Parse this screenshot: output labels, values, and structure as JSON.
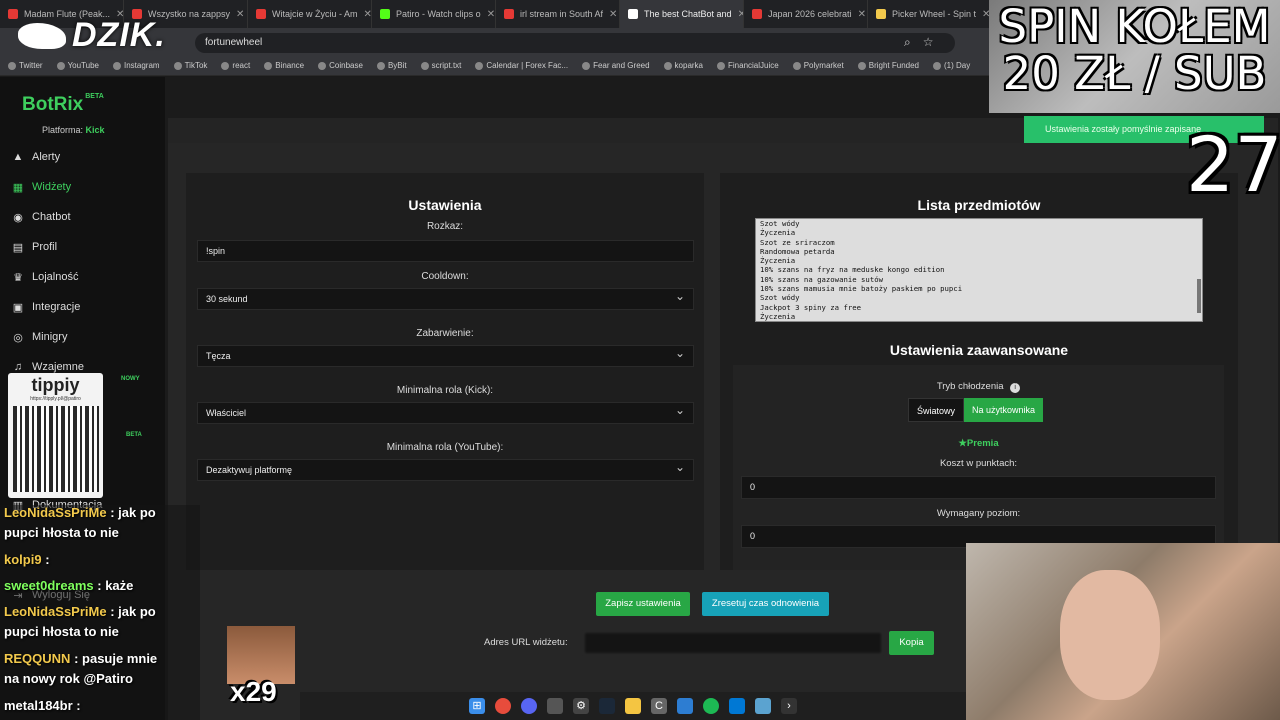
{
  "browser": {
    "tabs": [
      {
        "label": "Madam Flute (Peak...",
        "color": "#e53935"
      },
      {
        "label": "Wszystko na zappsy",
        "color": "#e53935"
      },
      {
        "label": "Witajcie w Życiu - Am",
        "color": "#e53935"
      },
      {
        "label": "Patiro - Watch clips o",
        "color": "#53fc18"
      },
      {
        "label": "irl stream in South Af",
        "color": "#e53935"
      },
      {
        "label": "The best ChatBot and",
        "color": "#ffffff"
      },
      {
        "label": "Japan 2026 celebrati",
        "color": "#e53935"
      },
      {
        "label": "Picker Wheel - Spin t",
        "color": "#f2c94c"
      }
    ],
    "address": "fortunewheel",
    "bookmarks": [
      "Twitter",
      "YouTube",
      "Instagram",
      "TikTok",
      "react",
      "Binance",
      "Coinbase",
      "ByBit",
      "script.txt",
      "Calendar | Forex Fac...",
      "Fear and Greed",
      "koparka",
      "FinancialJuice",
      "Polymarket",
      "Bright Funded",
      "(1) Day"
    ]
  },
  "overlay": {
    "dzik_logo": "DZIK.",
    "spin_line1": "SPIN KOŁEM",
    "spin_line2": "20 ZŁ / SUB",
    "counter": "27",
    "qr_title": "tippiy",
    "qr_url": "https://tipply.pl/@patiro",
    "emote_count": "x29"
  },
  "sidebar": {
    "brand": "BotRix",
    "brand_badge": "BETA",
    "platform_label": "Platforma:",
    "platform_value": "Kick",
    "items": [
      {
        "label": "Alerty",
        "icon": "bell-icon"
      },
      {
        "label": "Widżety",
        "icon": "grid-icon"
      },
      {
        "label": "Chatbot",
        "icon": "robot-icon"
      },
      {
        "label": "Profil",
        "icon": "id-card-icon"
      },
      {
        "label": "Lojalność",
        "icon": "trophy-icon"
      },
      {
        "label": "Integracje",
        "icon": "gear-icon"
      },
      {
        "label": "Minigry",
        "icon": "gamepad-icon"
      },
      {
        "label": "Wzajemne",
        "icon": "music-icon"
      },
      {
        "label": "Dokumentacja",
        "icon": "book-icon"
      },
      {
        "label": "Wyloguj Się",
        "icon": "logout-icon"
      }
    ],
    "badge_new": "NOWY",
    "badge_beta": "BETA"
  },
  "settings": {
    "title": "Ustawienia",
    "command_label": "Rozkaz:",
    "command_value": "!spin",
    "cooldown_label": "Cooldown:",
    "cooldown_value": "30 sekund",
    "color_label": "Zabarwienie:",
    "color_value": "Tęcza",
    "minrole_kick_label": "Minimalna rola (Kick):",
    "minrole_kick_value": "Właściciel",
    "minrole_yt_label": "Minimalna rola (YouTube):",
    "minrole_yt_value": "Dezaktywuj platformę"
  },
  "items": {
    "title": "Lista przedmiotów",
    "list": [
      "Szot wódy",
      "Życzenia",
      "Szot ze sriraczom",
      "Randomowa petarda",
      "Życzenia",
      "10% szans na fryz na meduske kongo edition",
      "10% szans na gazowanie sutów",
      "10% szans mamusia mnie batoży paskiem po pupci",
      "Szot wódy",
      "Jackpot 3 spiny za free",
      "Życzenia"
    ]
  },
  "advanced": {
    "title": "Ustawienia zaawansowane",
    "cooldown_mode_label": "Tryb chłodzenia",
    "mode_global": "Światowy",
    "mode_user": "Na użytkownika",
    "premium": "Premia",
    "cost_label": "Koszt w punktach:",
    "cost_value": "0",
    "level_label": "Wymagany poziom:",
    "level_value": "0"
  },
  "actions": {
    "save": "Zapisz ustawienia",
    "reset": "Zresetuj czas odnowienia",
    "url_label": "Adres URL widżetu:",
    "copy": "Kopia"
  },
  "toast": "Ustawienia zostały pomyślnie zapisane",
  "chat": [
    {
      "name": "LeoNidaSsPriMe",
      "msg": ": jak po",
      "cls": "n1"
    },
    {
      "name": "",
      "msg": "pupci hłosta to nie",
      "cls": "n4"
    },
    {
      "name": "kolpi9",
      "msg": ":",
      "cls": "n1"
    },
    {
      "name": "sweet0dreams",
      "msg": ": każe",
      "cls": "n3"
    },
    {
      "name": "LeoNidaSsPriMe",
      "msg": ": jak po",
      "cls": "n1"
    },
    {
      "name": "",
      "msg": "pupci hłosta to nie",
      "cls": "n4"
    },
    {
      "name": "REQQUNN",
      "msg": ": pasuje mnie",
      "cls": "n1"
    },
    {
      "name": "",
      "msg": "na nowy rok @Patiro",
      "cls": "n4"
    },
    {
      "name": "metal184br",
      "msg": ":",
      "cls": "n4"
    }
  ],
  "colors": {
    "accent": "#28a745",
    "reset": "#17a2b8",
    "brand": "#3ecf5e"
  }
}
